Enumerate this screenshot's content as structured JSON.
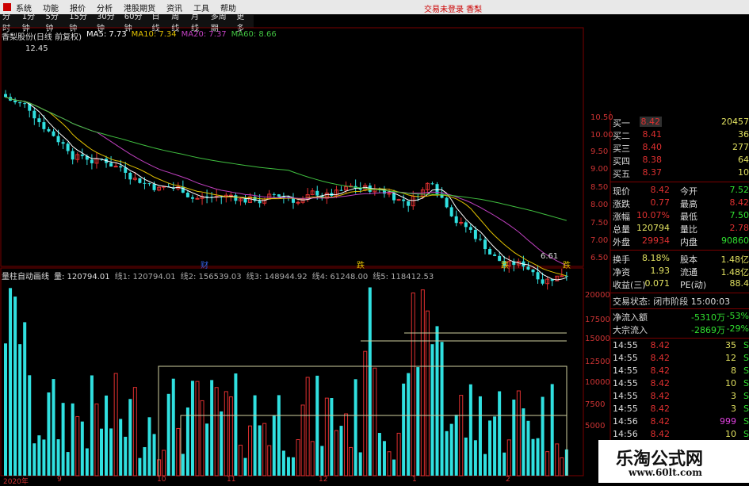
{
  "menu": {
    "items": [
      "系统",
      "功能",
      "报价",
      "分析",
      "港股期货",
      "资讯",
      "工具",
      "帮助"
    ],
    "right_text": "交易未登录 香梨"
  },
  "periods": [
    "分时",
    "1分钟",
    "5分钟",
    "15分钟",
    "30分钟",
    "60分钟",
    "日线",
    "周线",
    "月线",
    "多周期",
    "更多"
  ],
  "info": {
    "name": "香梨股份(日线 前复权)",
    "ma5": "MA5: 7.73",
    "ma10": "MA10: 7.34",
    "ma20": "MA20: 7.37",
    "ma60": "MA60: 8.66"
  },
  "vol_info": {
    "name": "量柱自动画线",
    "vol": "量: 120794.01",
    "l1": "线1: 120794.01",
    "l2": "线2: 156539.03",
    "l3": "线3: 148944.92",
    "l4": "线4: 61248.00",
    "l5": "线5: 118412.53"
  },
  "chart_annot": {
    "high": "12.45",
    "low": "6.61",
    "tags": [
      "财",
      "跌",
      "跌",
      "跌"
    ]
  },
  "price_axis": [
    "10.50",
    "10.00",
    "9.50",
    "9.00",
    "8.50",
    "8.00",
    "7.50",
    "7.00",
    "6.50"
  ],
  "vol_axis": [
    "20000",
    "17500",
    "15000",
    "12500",
    "10000",
    "7500",
    "5000"
  ],
  "date_axis": [
    "2020年",
    "9",
    "10",
    "11",
    "12",
    "1",
    "2"
  ],
  "quote": {
    "bids": [
      {
        "l": "买一",
        "p": "8.42",
        "v": "20457"
      },
      {
        "l": "买二",
        "p": "8.41",
        "v": "36"
      },
      {
        "l": "买三",
        "p": "8.40",
        "v": "277"
      },
      {
        "l": "买四",
        "p": "8.38",
        "v": "64"
      },
      {
        "l": "买五",
        "p": "8.37",
        "v": "10"
      }
    ],
    "stats": [
      {
        "l": "现价",
        "v": "8.42",
        "l2": "今开",
        "v2": "7.52"
      },
      {
        "l": "涨跌",
        "v": "0.77",
        "l2": "最高",
        "v2": "8.42"
      },
      {
        "l": "涨幅",
        "v": "10.07%",
        "l2": "最低",
        "v2": "7.50"
      },
      {
        "l": "总量",
        "v": "120794",
        "l2": "量比",
        "v2": "2.78"
      },
      {
        "l": "外盘",
        "v": "29934",
        "l2": "内盘",
        "v2": "90860"
      }
    ],
    "stats2": [
      {
        "l": "换手",
        "v": "8.18%",
        "l2": "股本",
        "v2": "1.48亿"
      },
      {
        "l": "净资",
        "v": "1.93",
        "l2": "流通",
        "v2": "1.48亿"
      },
      {
        "l": "收益(三)",
        "v": "0.071",
        "l2": "PE(动)",
        "v2": "88.4"
      }
    ],
    "status": "交易状态: 闭市阶段 15:00:03",
    "flows": [
      {
        "l": "净流入额",
        "v": "-5310万",
        "p": "-53%"
      },
      {
        "l": "大宗流入",
        "v": "-2869万",
        "p": "-29%"
      }
    ],
    "ticks": [
      {
        "t": "14:55",
        "p": "8.42",
        "v": "35",
        "s": "S"
      },
      {
        "t": "14:55",
        "p": "8.42",
        "v": "12",
        "s": "S"
      },
      {
        "t": "14:55",
        "p": "8.42",
        "v": "8",
        "s": "S"
      },
      {
        "t": "14:55",
        "p": "8.42",
        "v": "10",
        "s": "S"
      },
      {
        "t": "14:55",
        "p": "8.42",
        "v": "3",
        "s": "S"
      },
      {
        "t": "14:55",
        "p": "8.42",
        "v": "3",
        "s": "S"
      },
      {
        "t": "14:56",
        "p": "8.42",
        "v": "999",
        "s": "S"
      },
      {
        "t": "14:56",
        "p": "8.42",
        "v": "10",
        "s": "S"
      }
    ]
  },
  "logo": {
    "line1": "乐淘公式网",
    "line2": "www.60lt.com"
  },
  "colors": {
    "up": "#e03030",
    "down": "#30e0e0",
    "ma5": "#ffffff",
    "ma10": "#e0c000",
    "ma20": "#c040c0",
    "ma60": "#40c040",
    "grid": "#7a0000"
  }
}
